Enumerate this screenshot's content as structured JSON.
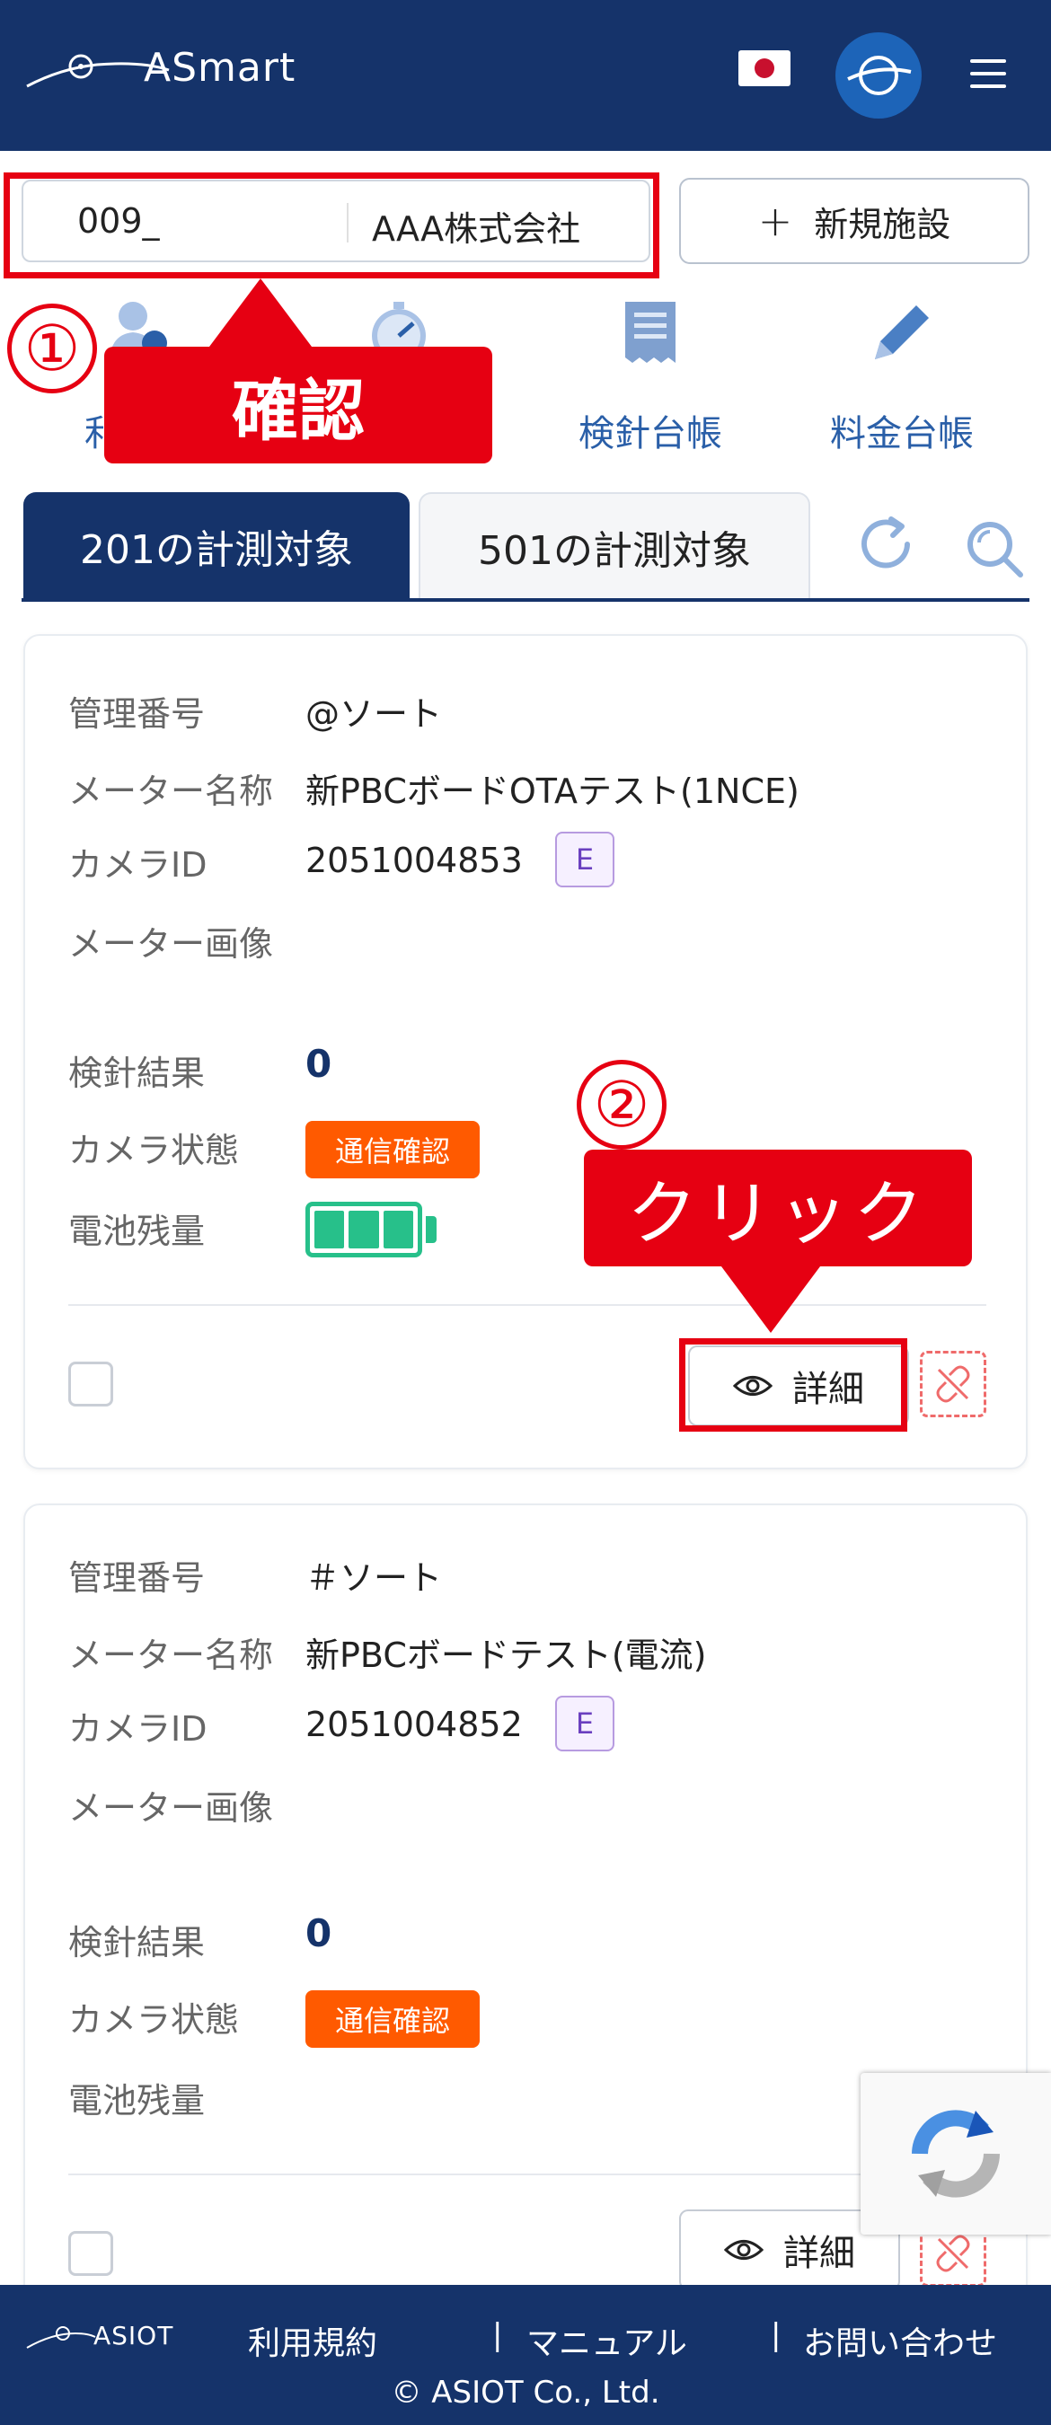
{
  "header": {
    "brand": "ASmart",
    "flag": "japan-flag",
    "avatar": "user-avatar"
  },
  "facility": {
    "code": "009_",
    "name": "AAA株式会社",
    "new_button": "新規施設",
    "new_button_icon": "+"
  },
  "annotations": {
    "step1_number": "①",
    "step1_label": "確認",
    "step2_number": "②",
    "step2_label": "クリック",
    "color": "#e60012"
  },
  "nav": {
    "items": [
      {
        "label": "",
        "icon": "user-icon"
      },
      {
        "label": "",
        "icon": "gauge-icon"
      },
      {
        "label": "検針台帳",
        "icon": "receipt-icon"
      },
      {
        "label": "料金台帳",
        "icon": "pencil-icon"
      }
    ],
    "partial_label": "利"
  },
  "tabs": {
    "active": "201の計測対象",
    "inactive": "501の計測対象"
  },
  "labels": {
    "management_no": "管理番号",
    "meter_name": "メーター名称",
    "camera_id": "カメラID",
    "meter_image": "メーター画像",
    "reading_result": "検針結果",
    "camera_status": "カメラ状態",
    "battery": "電池残量",
    "detail_button": "詳細"
  },
  "cards": [
    {
      "management_no": "@ソート",
      "meter_name": "新PBCボードOTAテスト(1NCE)",
      "camera_id": "2051004853",
      "camera_badge": "E",
      "reading_result": "0",
      "camera_status": "通信確認",
      "battery_level": 1.0
    },
    {
      "management_no": "＃ソート",
      "meter_name": "新PBCボードテスト(電流)",
      "camera_id": "2051004852",
      "camera_badge": "E",
      "reading_result": "0",
      "camera_status": "通信確認"
    }
  ],
  "footer": {
    "brand": "ASIOT",
    "links": [
      "利用規約",
      "マニュアル",
      "お問い合わせ"
    ],
    "separator": "|",
    "copyright": "© ASIOT Co., Ltd."
  },
  "colors": {
    "primary": "#15336a",
    "status_orange": "#ff5a00",
    "battery_green": "#27c08a",
    "badge_purple": "#6a3fbf"
  }
}
